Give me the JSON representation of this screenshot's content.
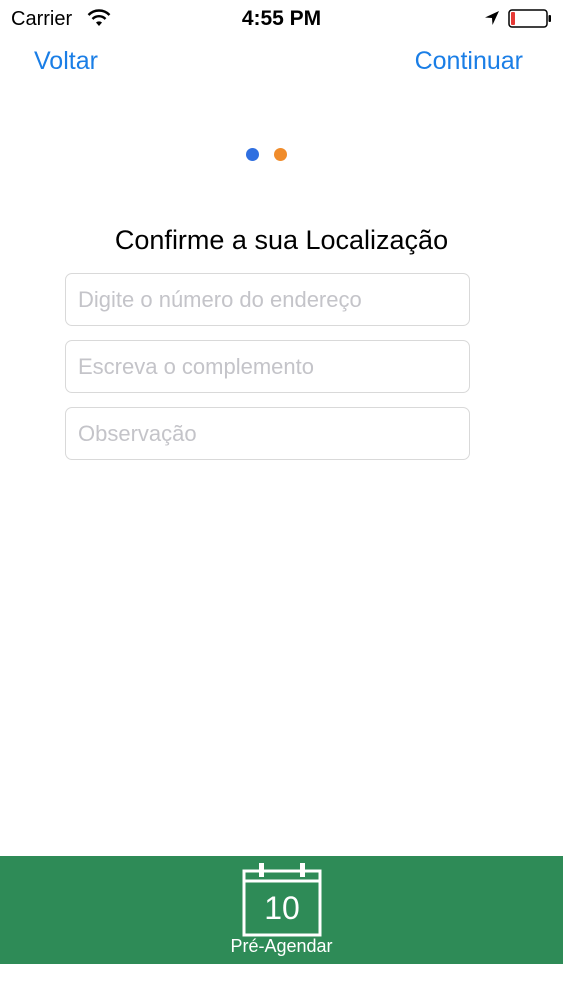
{
  "status_bar": {
    "carrier": "Carrier",
    "time": "4:55 PM",
    "battery_color": "#e53935"
  },
  "nav": {
    "back_label": "Voltar",
    "continue_label": "Continuar",
    "link_color": "#1a7ee6"
  },
  "page_indicator": {
    "total": 2,
    "dot_colors": [
      "#2f6fe0",
      "#f08c2b"
    ]
  },
  "form": {
    "title": "Confirme a sua Localização",
    "fields": [
      {
        "placeholder": "Digite o número do endereço",
        "value": ""
      },
      {
        "placeholder": "Escreva o complemento",
        "value": ""
      },
      {
        "placeholder": "Observação",
        "value": ""
      }
    ]
  },
  "bottom_bar": {
    "icon": "calendar-icon",
    "calendar_number": "10",
    "label": "Pré-Agendar",
    "background": "#2e8b57"
  }
}
